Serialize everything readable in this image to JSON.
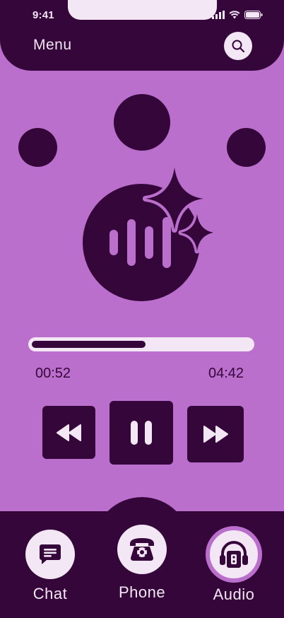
{
  "status_bar": {
    "time": "9:41"
  },
  "header": {
    "menu_label": "Menu",
    "search_icon": "search-icon"
  },
  "player": {
    "elapsed": "00:52",
    "duration": "04:42",
    "progress_fraction": 0.52,
    "controls": {
      "rewind_icon": "rewind-icon",
      "pause_icon": "pause-icon",
      "forward_icon": "fast-forward-icon"
    }
  },
  "bottom_nav": {
    "items": [
      {
        "label": "Chat",
        "icon": "chat-icon",
        "active": false
      },
      {
        "label": "Phone",
        "icon": "phone-icon",
        "active": false
      },
      {
        "label": "Audio",
        "icon": "audio-icon",
        "active": true
      }
    ]
  },
  "colors": {
    "background": "#bb6fcc",
    "dark": "#35063a",
    "light": "#f3e6f5"
  }
}
